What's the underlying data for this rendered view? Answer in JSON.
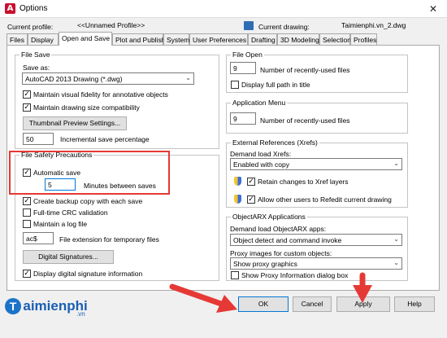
{
  "window": {
    "title": "Options",
    "close_glyph": "✕",
    "app_icon": "A"
  },
  "header": {
    "profile_label": "Current profile:",
    "profile_value": "<<Unnamed Profile>>",
    "drawing_label": "Current drawing:",
    "drawing_value": "Taimienphi.vn_2.dwg"
  },
  "tabs": [
    {
      "label": "Files"
    },
    {
      "label": "Display"
    },
    {
      "label": "Open and Save",
      "active": true
    },
    {
      "label": "Plot and Publish"
    },
    {
      "label": "System"
    },
    {
      "label": "User Preferences"
    },
    {
      "label": "Drafting"
    },
    {
      "label": "3D Modeling"
    },
    {
      "label": "Selection"
    },
    {
      "label": "Profiles"
    }
  ],
  "file_save": {
    "title": "File Save",
    "save_as_label": "Save as:",
    "save_as_value": "AutoCAD 2013 Drawing (*.dwg)",
    "maintain_visual": "Maintain visual fidelity for annotative objects",
    "maintain_visual_checked": true,
    "maintain_size": "Maintain drawing size compatibility",
    "maintain_size_checked": true,
    "thumbnail_button": "Thumbnail Preview Settings...",
    "incremental_value": "50",
    "incremental_label": "Incremental save percentage"
  },
  "safety": {
    "title": "File Safety Precautions",
    "autosave": "Automatic save",
    "autosave_checked": true,
    "minutes_value": "5",
    "minutes_label": "Minutes between saves",
    "backup": "Create backup copy with each save",
    "backup_checked": true,
    "crc": "Full-time CRC validation",
    "crc_checked": false,
    "log": "Maintain a log file",
    "log_checked": false,
    "ext_value": "ac$",
    "ext_label": "File extension for temporary files",
    "sig_button": "Digital Signatures...",
    "display_sig": "Display digital signature information",
    "display_sig_checked": true
  },
  "file_open": {
    "title": "File Open",
    "recent_value": "9",
    "recent_label": "Number of recently-used files",
    "full_path": "Display full path in title",
    "full_path_checked": false
  },
  "app_menu": {
    "title": "Application Menu",
    "recent_value": "9",
    "recent_label": "Number of recently-used files"
  },
  "xrefs": {
    "title": "External References (Xrefs)",
    "demand_label": "Demand load Xrefs:",
    "demand_value": "Enabled with copy",
    "retain": "Retain changes to Xref layers",
    "retain_checked": true,
    "allow": "Allow other users to Refedit current drawing",
    "allow_checked": true
  },
  "objectarx": {
    "title": "ObjectARX Applications",
    "demand_label": "Demand load ObjectARX apps:",
    "demand_value": "Object detect and command invoke",
    "proxy_label": "Proxy images for custom objects:",
    "proxy_value": "Show proxy graphics",
    "show_proxy": "Show Proxy Information dialog box",
    "show_proxy_checked": false
  },
  "buttons": {
    "ok": "OK",
    "cancel": "Cancel",
    "apply": "Apply",
    "help": "Help"
  },
  "brand": {
    "text": "aimienphi",
    "suffix": ".vn",
    "letter": "T"
  },
  "colors": {
    "highlight": "#e53935",
    "accent": "#0078d7"
  }
}
